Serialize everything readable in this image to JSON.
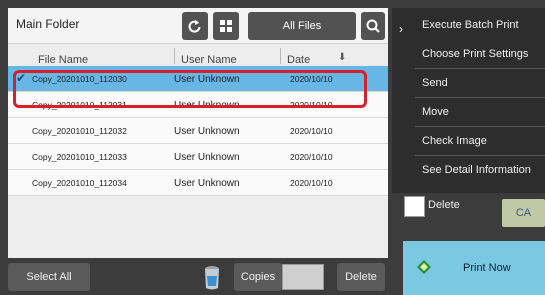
{
  "header": {
    "folder_title": "Main Folder",
    "filter_label": "All Files"
  },
  "columns": {
    "file_name": "File Name",
    "user_name": "User Name",
    "date": "Date"
  },
  "files": [
    {
      "name": "Copy_20201010_112030",
      "user": "User Unknown",
      "date": "2020/10/10",
      "selected": true
    },
    {
      "name": "Copy_20201010_112031",
      "user": "User Unknown",
      "date": "2020/10/10",
      "selected": false
    },
    {
      "name": "Copy_20201010_112032",
      "user": "User Unknown",
      "date": "2020/10/10",
      "selected": false
    },
    {
      "name": "Copy_20201010_112033",
      "user": "User Unknown",
      "date": "2020/10/10",
      "selected": false
    },
    {
      "name": "Copy_20201010_112034",
      "user": "User Unknown",
      "date": "2020/10/10",
      "selected": false
    }
  ],
  "toolbar": {
    "select_all": "Select All",
    "copies_label": "Copies",
    "copies_value": "",
    "delete": "Delete"
  },
  "menu": {
    "items": [
      "Execute Batch Print",
      "Choose Print Settings",
      "Send",
      "Move",
      "Check Image",
      "See Detail Information"
    ]
  },
  "options": {
    "delete_label": "Delete",
    "delete_checked": false,
    "ca_label": "CA"
  },
  "print_now": "Print Now",
  "colors": {
    "selected_row": "#66b6e6",
    "highlight_outline": "#d6202a",
    "print_now_bg": "#7ac8e2",
    "ca_bg": "#c1c8a4"
  }
}
